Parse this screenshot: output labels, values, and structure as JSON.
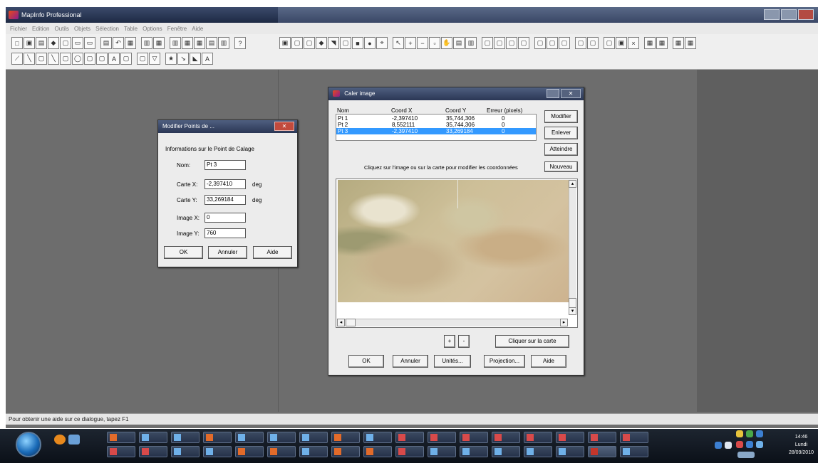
{
  "app": {
    "title": "MapInfo Professional",
    "menu": [
      "Fichier",
      "Edition",
      "Outils",
      "Objets",
      "Sélection",
      "Table",
      "Options",
      "Fenêtre",
      "Aide"
    ]
  },
  "status": {
    "text": "Pour obtenir une aide sur ce dialogue, tapez F1"
  },
  "modify_dialog": {
    "title": "Modifier Points de ...",
    "heading": "Informations sur le Point de Calage",
    "nom_label": "Nom:",
    "nom_value": "Pt 3",
    "cartex_label": "Carte X:",
    "cartex_value": "-2,397410",
    "cartey_label": "Carte Y:",
    "cartey_value": "33,269184",
    "unit": "deg",
    "imagex_label": "Image X:",
    "imagex_value": "0",
    "imagey_label": "Image Y:",
    "imagey_value": "760",
    "ok": "OK",
    "cancel": "Annuler",
    "help": "Aide"
  },
  "caler_dialog": {
    "title": "Caler image",
    "columns": [
      "Nom",
      "Coord X",
      "Coord Y",
      "Erreur (pixels)"
    ],
    "rows": [
      [
        "Pt 1",
        "-2,397410",
        "35,744,306",
        "0"
      ],
      [
        "Pt 2",
        "8,552111",
        "35,744,306",
        "0"
      ],
      [
        "Pt 3",
        "-2,397410",
        "33,269184",
        "0"
      ]
    ],
    "modifier": "Modifier",
    "enlever": "Enlever",
    "atteindre": "Atteindre",
    "instruction": "Cliquez sur l'image ou sur la carte pour modifier les coordonnées",
    "nouveau": "Nouveau",
    "plus": "+",
    "minus": "-",
    "cliquer_carte": "Cliquer sur la carte",
    "ok": "OK",
    "cancel": "Annuler",
    "unites": "Unités...",
    "projection": "Projection...",
    "help": "Aide"
  },
  "tray": {
    "time": "14:46",
    "day": "Lundi",
    "date": "28/09/2010"
  }
}
